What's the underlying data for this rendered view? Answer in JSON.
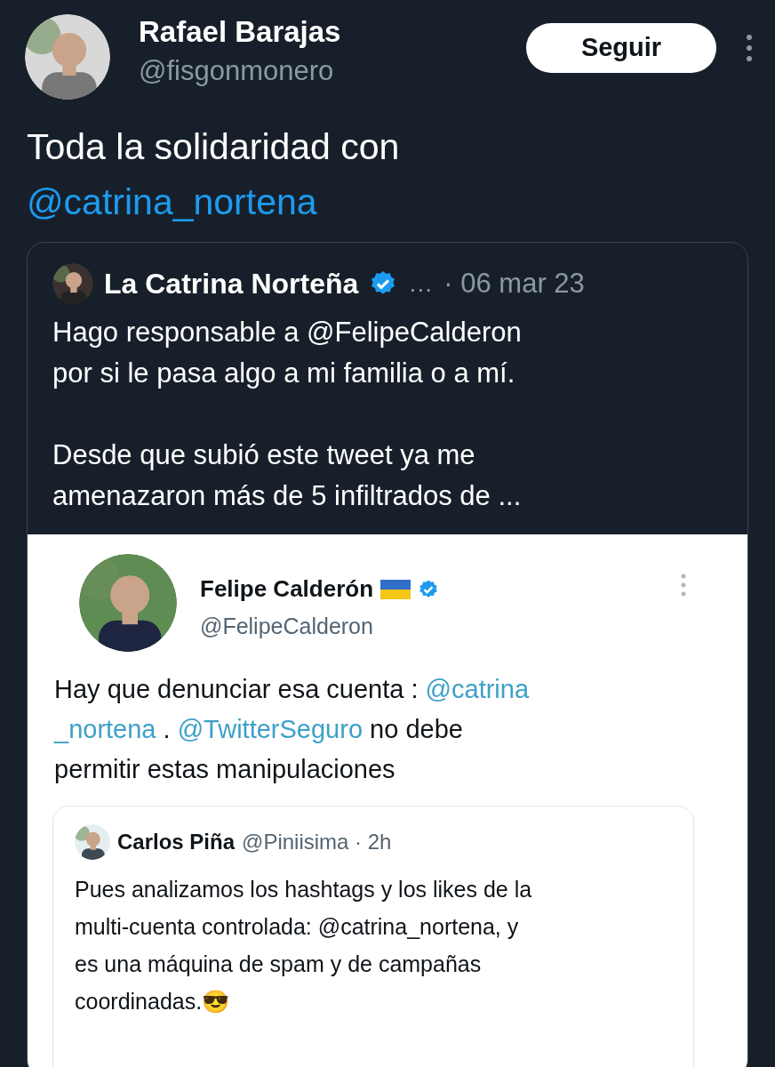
{
  "author": {
    "name": "Rafael Barajas",
    "handle": "@fisgonmonero"
  },
  "follow_button": {
    "label": "Seguir"
  },
  "tweet_text": [
    [
      {
        "kind": "text",
        "text": "Toda la solidaridad con"
      }
    ],
    [
      {
        "kind": "mention",
        "text": "@catrina_nortena"
      }
    ]
  ],
  "quoted_tweet": {
    "name": "La Catrina Norteña",
    "verified": true,
    "ellipsis": "…",
    "date": "· 06 mar 23",
    "paragraphs": [
      [
        [
          {
            "kind": "text",
            "text": "Hago responsable a @FelipeCalderon"
          }
        ],
        [
          {
            "kind": "text",
            "text": "por si le pasa algo a mi familia o a mí."
          }
        ]
      ],
      [
        [
          {
            "kind": "text",
            "text": "Desde que subió este tweet ya me"
          }
        ],
        [
          {
            "kind": "text",
            "text": "amenazaron más de 5 infiltrados de ..."
          }
        ]
      ]
    ],
    "screenshot": {
      "name": "Felipe Calderón",
      "flag": true,
      "verified": true,
      "handle": "@FelipeCalderon",
      "text": [
        [
          {
            "kind": "text",
            "text": "Hay que denunciar esa cuenta : "
          },
          {
            "kind": "mention",
            "text": "@catrina"
          }
        ],
        [
          {
            "kind": "mention",
            "text": "_nortena"
          },
          {
            "kind": "text",
            "text": " . "
          },
          {
            "kind": "mention",
            "text": "@TwitterSeguro"
          },
          {
            "kind": "text",
            "text": " no debe"
          }
        ],
        [
          {
            "kind": "text",
            "text": "permitir estas manipulaciones"
          }
        ]
      ],
      "quote": {
        "name": "Carlos Piña",
        "handle": "@Piniisima · 2h",
        "text": [
          [
            {
              "kind": "text",
              "text": "Pues analizamos los hashtags y los likes de la"
            }
          ],
          [
            {
              "kind": "text",
              "text": "multi-cuenta controlada: @catrina_nortena, y"
            }
          ],
          [
            {
              "kind": "text",
              "text": "es una máquina de spam y de campañas"
            }
          ],
          [
            {
              "kind": "text",
              "text": "coordinadas.😎"
            }
          ]
        ]
      }
    }
  }
}
